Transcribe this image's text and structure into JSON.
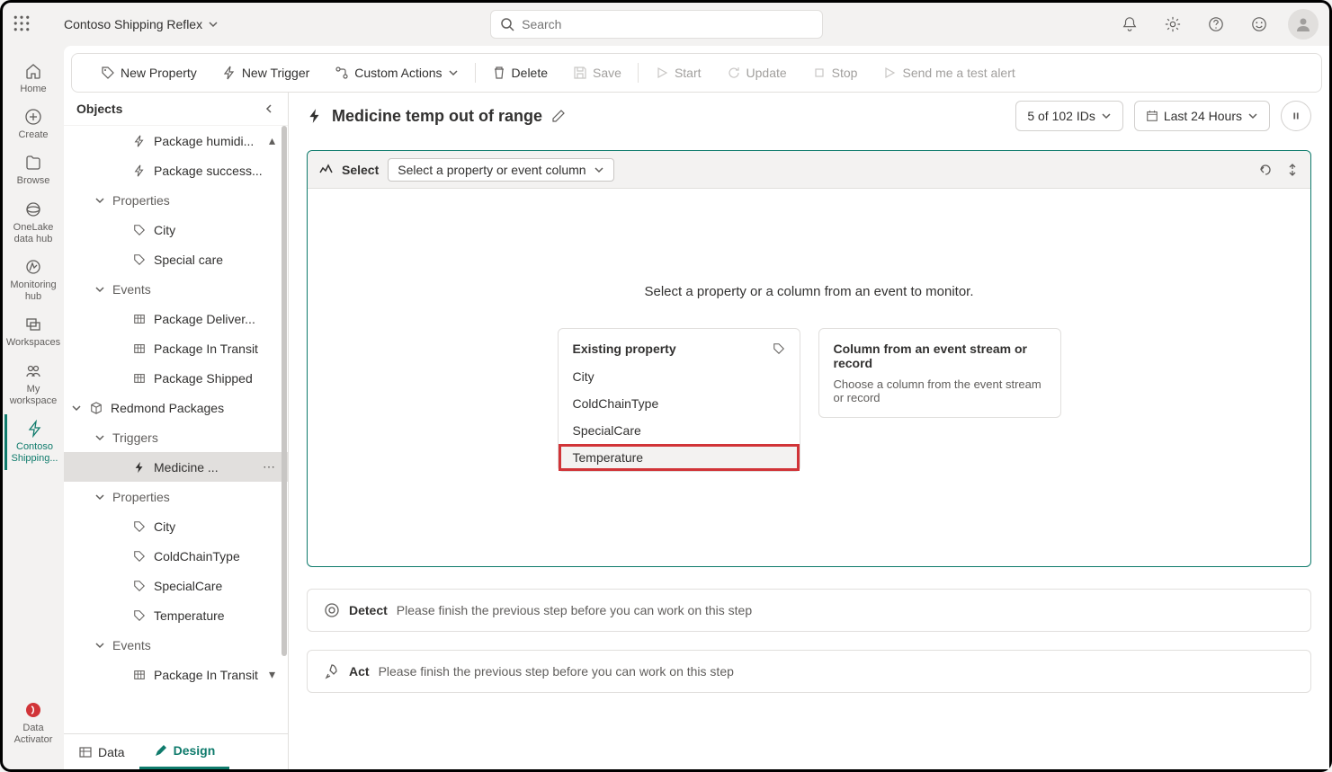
{
  "header": {
    "app_title": "Contoso Shipping Reflex",
    "search_placeholder": "Search"
  },
  "leftnav": {
    "items": [
      {
        "label": "Home"
      },
      {
        "label": "Create"
      },
      {
        "label": "Browse"
      },
      {
        "label": "OneLake data hub"
      },
      {
        "label": "Monitoring hub"
      },
      {
        "label": "Workspaces"
      },
      {
        "label": "My workspace"
      },
      {
        "label": "Contoso Shipping..."
      }
    ],
    "bottom_label": "Data Activator"
  },
  "toolbar": {
    "new_property": "New Property",
    "new_trigger": "New Trigger",
    "custom_actions": "Custom Actions",
    "delete": "Delete",
    "save": "Save",
    "start": "Start",
    "update": "Update",
    "stop": "Stop",
    "send_test": "Send me a test alert"
  },
  "objects_panel": {
    "title": "Objects",
    "tree": {
      "trigger1": "Package humidi...",
      "trigger2": "Package success...",
      "properties_label": "Properties",
      "prop_city": "City",
      "prop_special": "Special care",
      "events_label": "Events",
      "evt_delivered": "Package Deliver...",
      "evt_transit": "Package In Transit",
      "evt_shipped": "Package Shipped",
      "redmond": "Redmond Packages",
      "triggers_label": "Triggers",
      "trigger_medicine": "Medicine ...",
      "properties2_label": "Properties",
      "p2_city": "City",
      "p2_cold": "ColdChainType",
      "p2_special": "SpecialCare",
      "p2_temp": "Temperature",
      "events2_label": "Events",
      "evt2_transit": "Package In Transit"
    }
  },
  "design": {
    "title": "Medicine temp out of range",
    "ids_pill": "5 of 102 IDs",
    "time_pill": "Last 24 Hours",
    "select_label": "Select",
    "select_dropdown": "Select a property or event column",
    "hint": "Select a property or a column from an event to monitor.",
    "existing_property": {
      "title": "Existing property",
      "items": [
        "City",
        "ColdChainType",
        "SpecialCare",
        "Temperature"
      ]
    },
    "event_column": {
      "title": "Column from an event stream or record",
      "desc": "Choose a column from the event stream or record"
    },
    "detect_label": "Detect",
    "detect_msg": "Please finish the previous step before you can work on this step",
    "act_label": "Act",
    "act_msg": "Please finish the previous step before you can work on this step"
  },
  "bottom_tabs": {
    "data": "Data",
    "design": "Design"
  }
}
